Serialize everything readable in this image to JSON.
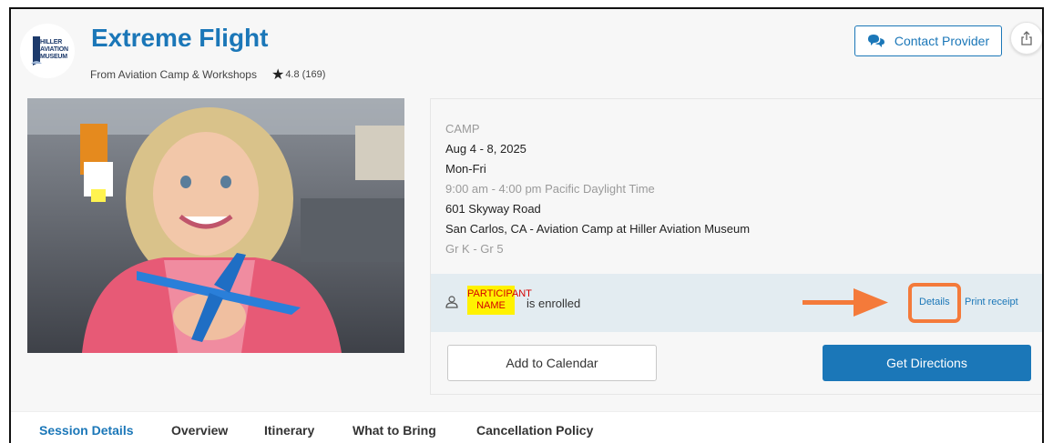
{
  "header": {
    "logo_text": [
      "HILLER",
      "AVIATION",
      "MUSEUM"
    ],
    "title": "Extreme Flight",
    "provider": "From Aviation Camp & Workshops",
    "rating": "4.8",
    "rating_count": "(169)",
    "contact_label": "Contact Provider"
  },
  "session": {
    "category": "CAMP",
    "dates": "Aug 4 - 8, 2025",
    "days": "Mon-Fri",
    "time": "9:00 am - 4:00 pm Pacific Daylight Time",
    "street": "601 Skyway Road",
    "location": "San Carlos, CA - Aviation Camp at Hiller Aviation Museum",
    "grades": "Gr K - Gr 5"
  },
  "enrollment": {
    "participant_line1": "PARTICIPANT",
    "participant_line2": "NAME",
    "status": "is enrolled",
    "details_label": "Details",
    "print_label": "Print receipt"
  },
  "actions": {
    "calendar_label": "Add to Calendar",
    "directions_label": "Get Directions"
  },
  "tabs": [
    {
      "label": "Session Details",
      "active": true
    },
    {
      "label": "Overview",
      "active": false
    },
    {
      "label": "Itinerary",
      "active": false
    },
    {
      "label": "What to Bring",
      "active": false
    },
    {
      "label": "Cancellation Policy",
      "active": false
    }
  ],
  "colors": {
    "brand_blue": "#1b77b8",
    "highlight_orange": "#f47a3a",
    "redaction_yellow": "#fff200"
  }
}
